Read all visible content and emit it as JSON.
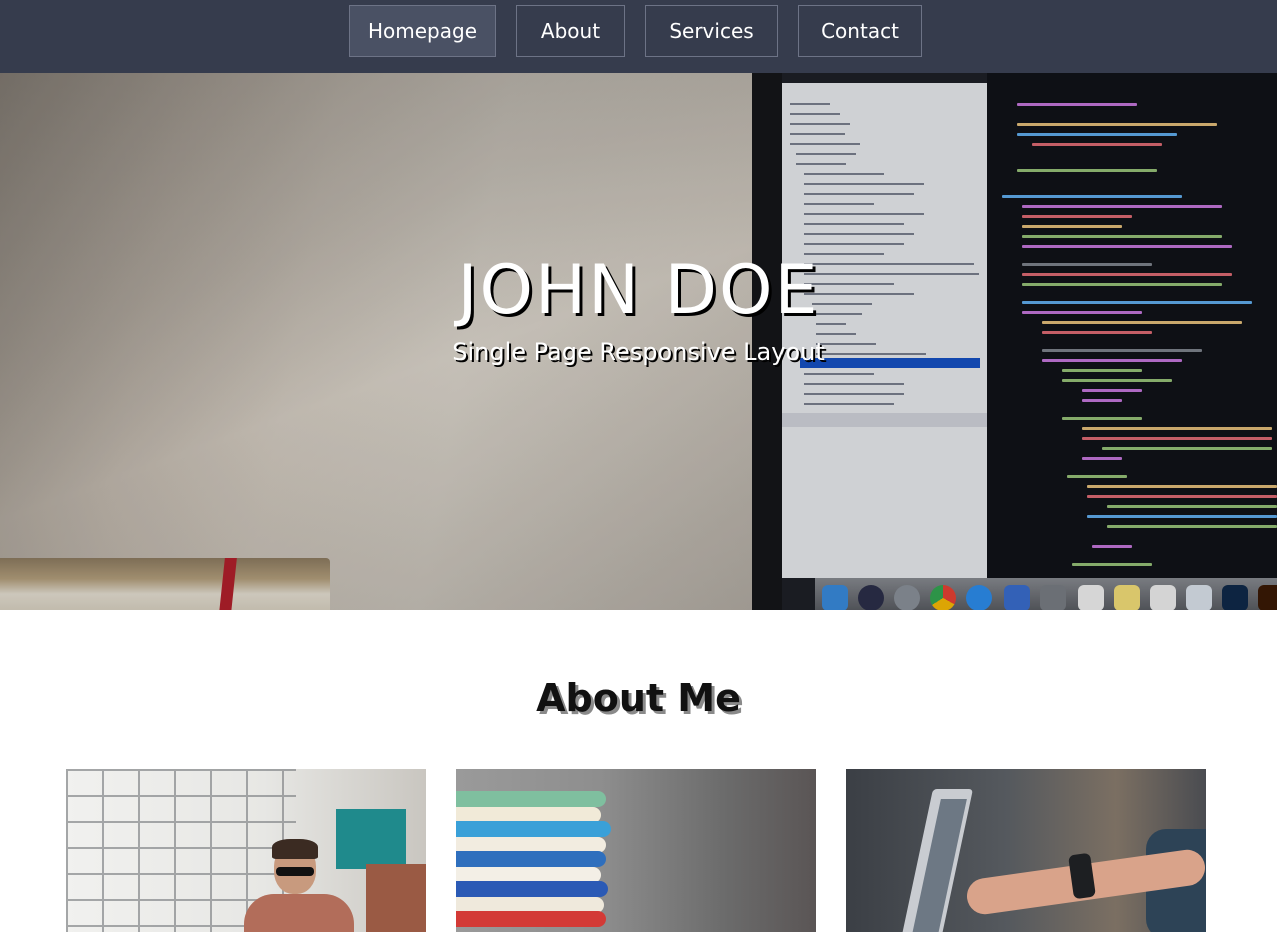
{
  "nav": {
    "items": [
      {
        "label": "Homepage",
        "active": true
      },
      {
        "label": "About",
        "active": false
      },
      {
        "label": "Services",
        "active": false
      },
      {
        "label": "Contact",
        "active": false
      }
    ]
  },
  "hero": {
    "title": "JOHN DOE",
    "subtitle": "Single Page Responsive Layout"
  },
  "about": {
    "title": "About Me"
  },
  "colors": {
    "nav_bg": "#363c4d",
    "nav_active_bg": "#4a5164",
    "text_light": "#ffffff"
  }
}
